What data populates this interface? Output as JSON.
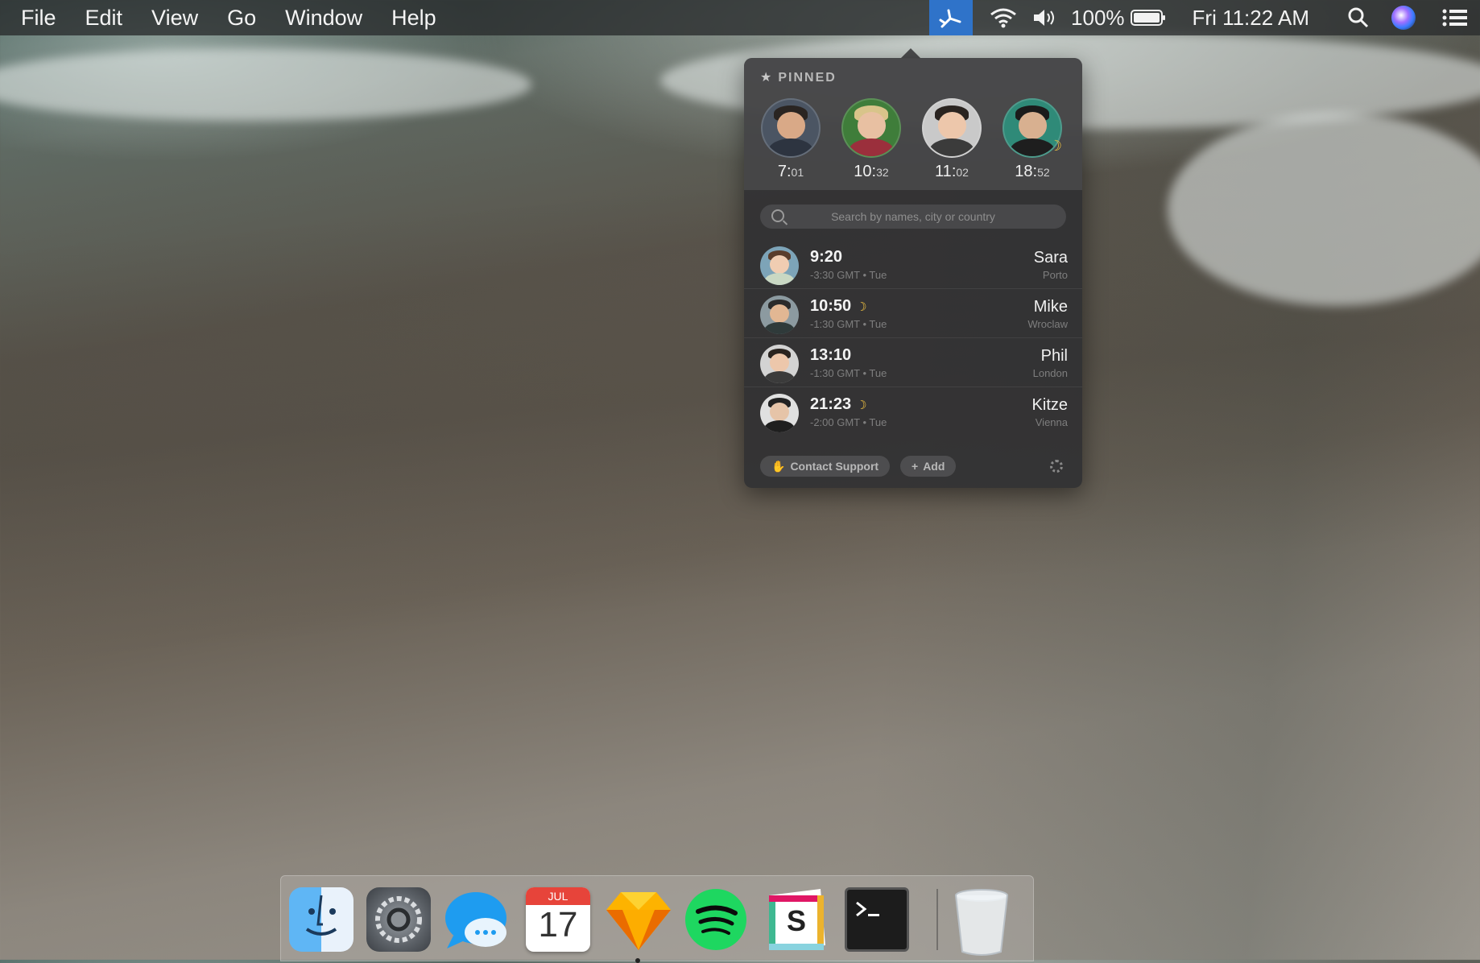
{
  "menubar": {
    "apple_menu": [
      "File",
      "Edit",
      "View",
      "Go",
      "Window",
      "Help"
    ],
    "battery_label": "100%",
    "clock_label": "Fri 11:22 AM",
    "accent_color": "#2f73c9"
  },
  "popover": {
    "pinned_header": "PINNED",
    "pinned": [
      {
        "hour": "7",
        "min": "01",
        "night": false
      },
      {
        "hour": "10",
        "min": "32",
        "night": false
      },
      {
        "hour": "11",
        "min": "02",
        "night": false
      },
      {
        "hour": "18",
        "min": "52",
        "night": true
      }
    ],
    "search_placeholder": "Search by names, city or country",
    "people": [
      {
        "time": "9:20",
        "offset": "-3:30 GMT • Tue",
        "name": "Sara",
        "city": "Porto",
        "night": false
      },
      {
        "time": "10:50",
        "offset": "-1:30 GMT • Tue",
        "name": "Mike",
        "city": "Wroclaw",
        "night": true
      },
      {
        "time": "13:10",
        "offset": "-1:30 GMT • Tue",
        "name": "Phil",
        "city": "London",
        "night": false
      },
      {
        "time": "21:23",
        "offset": "-2:00 GMT • Tue",
        "name": "Kitze",
        "city": "Vienna",
        "night": true
      }
    ],
    "contact_support_label": "Contact Support",
    "add_label": "Add",
    "moon_glyph": "☽"
  },
  "dock": {
    "calendar_month": "JUL",
    "calendar_day": "17",
    "apps": [
      "finder-icon",
      "system-preferences-icon",
      "messages-icon",
      "calendar-icon",
      "sketch-icon",
      "spotify-icon",
      "slack-icon",
      "terminal-icon",
      "trash-icon"
    ]
  }
}
